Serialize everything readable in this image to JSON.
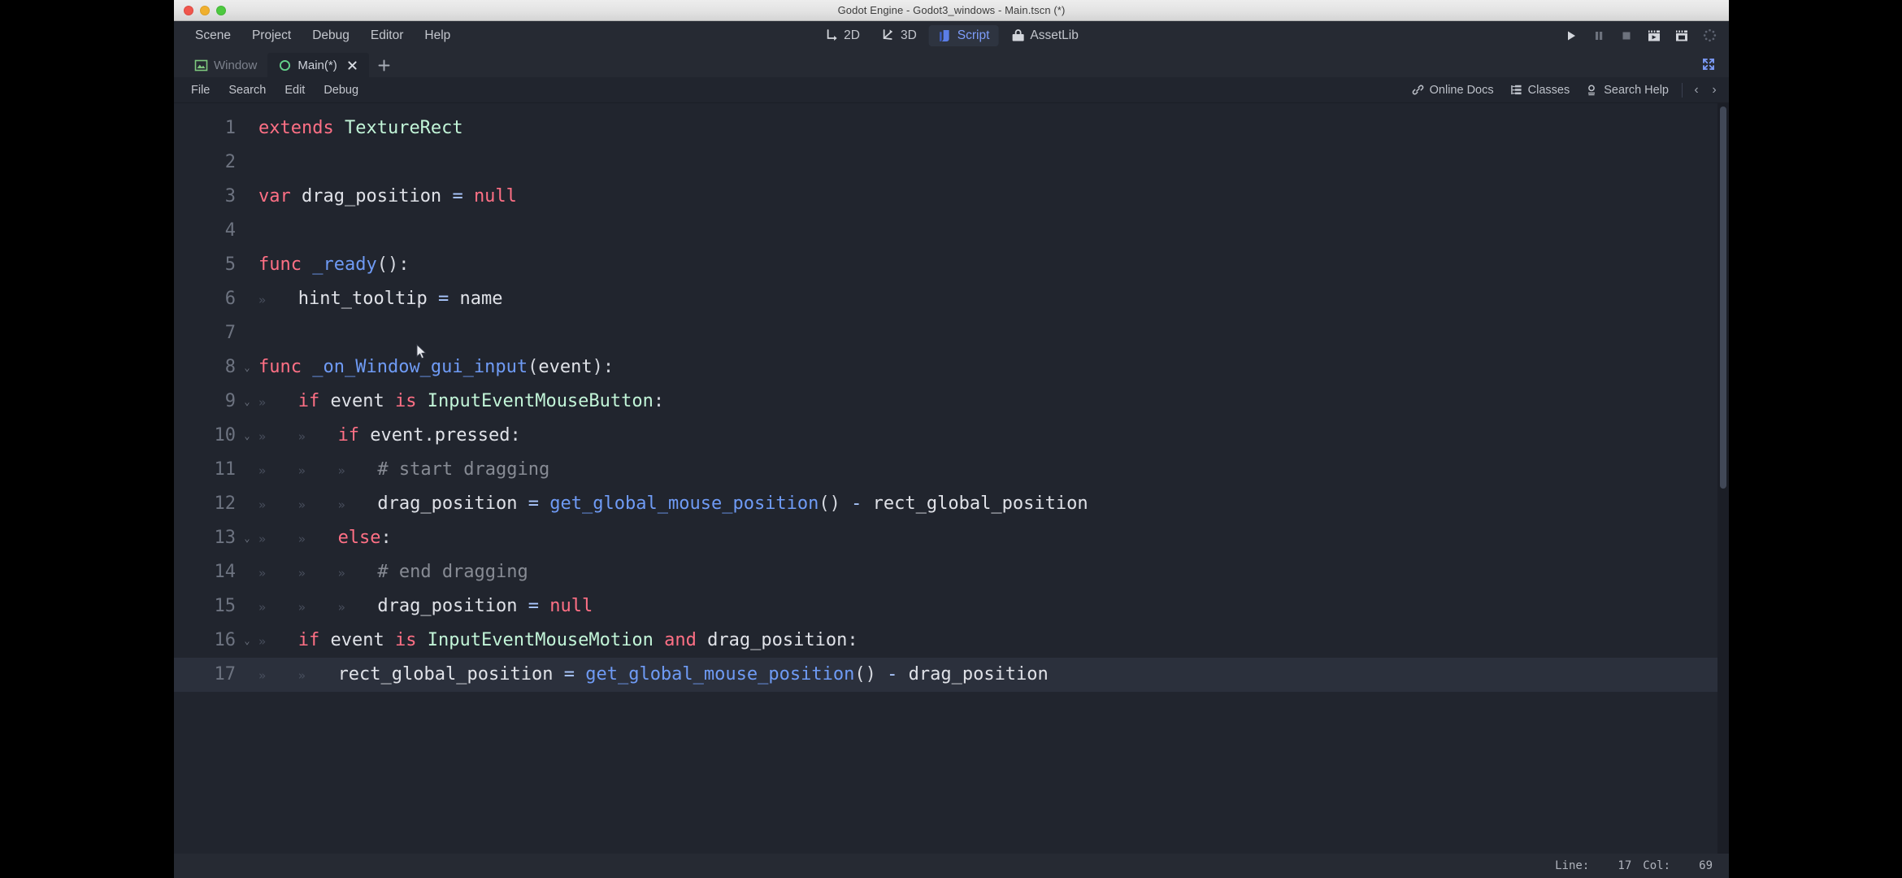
{
  "window": {
    "title": "Godot Engine - Godot3_windows - Main.tscn (*)",
    "controls": {
      "close": "close-button",
      "minimize": "minimize-button",
      "maximize": "maximize-button"
    }
  },
  "menubar": {
    "items": [
      {
        "label": "Scene",
        "name": "menu-scene"
      },
      {
        "label": "Project",
        "name": "menu-project"
      },
      {
        "label": "Debug",
        "name": "menu-debug"
      },
      {
        "label": "Editor",
        "name": "menu-editor"
      },
      {
        "label": "Help",
        "name": "menu-help"
      }
    ]
  },
  "main_tabs": {
    "active": "Script",
    "items": [
      {
        "label": "2D",
        "icon": "2d-icon",
        "active": false
      },
      {
        "label": "3D",
        "icon": "3d-icon",
        "active": false
      },
      {
        "label": "Script",
        "icon": "script-icon",
        "active": true
      },
      {
        "label": "AssetLib",
        "icon": "assetlib-icon",
        "active": false
      }
    ]
  },
  "playback": {
    "buttons": [
      {
        "name": "play-button",
        "icon": "play-icon"
      },
      {
        "name": "pause-button",
        "icon": "pause-icon"
      },
      {
        "name": "stop-button",
        "icon": "stop-icon"
      },
      {
        "name": "play-scene-button",
        "icon": "play-scene-icon"
      },
      {
        "name": "play-custom-scene-button",
        "icon": "play-custom-scene-icon"
      },
      {
        "name": "loading-spinner",
        "icon": "progress-spinner-icon"
      }
    ]
  },
  "script_tabs": {
    "items": [
      {
        "label": "Window",
        "icon": "texture-rect-icon",
        "active": false
      },
      {
        "label": "Main(*)",
        "icon": "script-file-icon",
        "active": true
      }
    ],
    "close_label": "✕",
    "add_label": "+",
    "distraction_free": "distraction-free-mode-icon"
  },
  "script_menu": {
    "items": [
      {
        "label": "File",
        "name": "script-menu-file"
      },
      {
        "label": "Search",
        "name": "script-menu-search"
      },
      {
        "label": "Edit",
        "name": "script-menu-edit"
      },
      {
        "label": "Debug",
        "name": "script-menu-debug"
      }
    ],
    "help": [
      {
        "label": "Online Docs",
        "icon": "link-icon",
        "name": "online-docs-button"
      },
      {
        "label": "Classes",
        "icon": "class-list-icon",
        "name": "classes-button"
      },
      {
        "label": "Search Help",
        "icon": "search-help-icon",
        "name": "search-help-button"
      }
    ],
    "nav_prev": "‹",
    "nav_next": "›"
  },
  "status": {
    "line_label": "Line:",
    "line_value": "17",
    "col_label": "Col:",
    "col_value": "69"
  },
  "editor": {
    "language": "GDScript",
    "colors": {
      "background": "#21252e",
      "chrome": "#262a33",
      "keyword": "#ff7085",
      "class": "#c2f5d8",
      "function": "#6f9bf5",
      "operator": "#abc8ff",
      "identifier": "#e0e2e8",
      "comment": "#878b94",
      "line_number": "#6d7380",
      "current_line": "#2b303c",
      "accent": "#7e9dfb"
    },
    "current_line": 17,
    "lines": [
      {
        "n": "1",
        "fold": "",
        "indent": 0,
        "tokens": [
          {
            "t": "extends",
            "c": "kw"
          },
          {
            "t": " ",
            "c": "id"
          },
          {
            "t": "TextureRect",
            "c": "cls"
          }
        ]
      },
      {
        "n": "2",
        "fold": "",
        "indent": 0,
        "tokens": []
      },
      {
        "n": "3",
        "fold": "",
        "indent": 0,
        "tokens": [
          {
            "t": "var",
            "c": "kw"
          },
          {
            "t": " drag_position ",
            "c": "id"
          },
          {
            "t": "=",
            "c": "op"
          },
          {
            "t": " ",
            "c": "id"
          },
          {
            "t": "null",
            "c": "kw"
          }
        ]
      },
      {
        "n": "4",
        "fold": "",
        "indent": 0,
        "tokens": []
      },
      {
        "n": "5",
        "fold": "",
        "indent": 0,
        "tokens": [
          {
            "t": "func",
            "c": "kw"
          },
          {
            "t": " ",
            "c": "id"
          },
          {
            "t": "_ready",
            "c": "fn"
          },
          {
            "t": "():",
            "c": "punc"
          }
        ]
      },
      {
        "n": "6",
        "fold": "",
        "indent": 1,
        "tokens": [
          {
            "t": "hint_tooltip ",
            "c": "id"
          },
          {
            "t": "=",
            "c": "op"
          },
          {
            "t": " name",
            "c": "id"
          }
        ]
      },
      {
        "n": "7",
        "fold": "",
        "indent": 0,
        "tokens": []
      },
      {
        "n": "8",
        "fold": "⌄",
        "indent": 0,
        "tokens": [
          {
            "t": "func",
            "c": "kw"
          },
          {
            "t": " ",
            "c": "id"
          },
          {
            "t": "_on_Window_gui_input",
            "c": "fn"
          },
          {
            "t": "(",
            "c": "punc"
          },
          {
            "t": "event",
            "c": "id"
          },
          {
            "t": "):",
            "c": "punc"
          }
        ]
      },
      {
        "n": "9",
        "fold": "⌄",
        "indent": 1,
        "tokens": [
          {
            "t": "if",
            "c": "kw"
          },
          {
            "t": " event ",
            "c": "id"
          },
          {
            "t": "is",
            "c": "kw"
          },
          {
            "t": " ",
            "c": "id"
          },
          {
            "t": "InputEventMouseButton",
            "c": "cls"
          },
          {
            "t": ":",
            "c": "punc"
          }
        ]
      },
      {
        "n": "10",
        "fold": "⌄",
        "indent": 2,
        "tokens": [
          {
            "t": "if",
            "c": "kw"
          },
          {
            "t": " event",
            "c": "id"
          },
          {
            "t": ".",
            "c": "punc"
          },
          {
            "t": "pressed",
            "c": "id"
          },
          {
            "t": ":",
            "c": "punc"
          }
        ]
      },
      {
        "n": "11",
        "fold": "",
        "indent": 3,
        "tokens": [
          {
            "t": "# start dragging",
            "c": "cmt"
          }
        ]
      },
      {
        "n": "12",
        "fold": "",
        "indent": 3,
        "tokens": [
          {
            "t": "drag_position ",
            "c": "id"
          },
          {
            "t": "=",
            "c": "op"
          },
          {
            "t": " ",
            "c": "id"
          },
          {
            "t": "get_global_mouse_position",
            "c": "fn"
          },
          {
            "t": "()",
            "c": "punc"
          },
          {
            "t": " ",
            "c": "id"
          },
          {
            "t": "-",
            "c": "op"
          },
          {
            "t": " rect_global_position",
            "c": "id"
          }
        ]
      },
      {
        "n": "13",
        "fold": "⌄",
        "indent": 2,
        "tokens": [
          {
            "t": "else",
            "c": "kw"
          },
          {
            "t": ":",
            "c": "punc"
          }
        ]
      },
      {
        "n": "14",
        "fold": "",
        "indent": 3,
        "tokens": [
          {
            "t": "# end dragging",
            "c": "cmt"
          }
        ]
      },
      {
        "n": "15",
        "fold": "",
        "indent": 3,
        "tokens": [
          {
            "t": "drag_position ",
            "c": "id"
          },
          {
            "t": "=",
            "c": "op"
          },
          {
            "t": " ",
            "c": "id"
          },
          {
            "t": "null",
            "c": "kw"
          }
        ]
      },
      {
        "n": "16",
        "fold": "⌄",
        "indent": 1,
        "tokens": [
          {
            "t": "if",
            "c": "kw"
          },
          {
            "t": " event ",
            "c": "id"
          },
          {
            "t": "is",
            "c": "kw"
          },
          {
            "t": " ",
            "c": "id"
          },
          {
            "t": "InputEventMouseMotion",
            "c": "cls"
          },
          {
            "t": " ",
            "c": "id"
          },
          {
            "t": "and",
            "c": "kw"
          },
          {
            "t": " drag_position",
            "c": "id"
          },
          {
            "t": ":",
            "c": "punc"
          }
        ]
      },
      {
        "n": "17",
        "fold": "",
        "indent": 2,
        "tokens": [
          {
            "t": "rect_global_position ",
            "c": "id"
          },
          {
            "t": "=",
            "c": "op"
          },
          {
            "t": " ",
            "c": "id"
          },
          {
            "t": "get_global_mouse_position",
            "c": "fn"
          },
          {
            "t": "()",
            "c": "punc"
          },
          {
            "t": " ",
            "c": "id"
          },
          {
            "t": "-",
            "c": "op"
          },
          {
            "t": " drag_position",
            "c": "id"
          }
        ]
      }
    ]
  }
}
